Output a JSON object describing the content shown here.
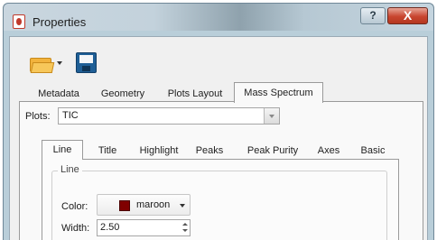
{
  "window": {
    "title": "Properties",
    "help_label": "?",
    "close_label": "X"
  },
  "toolbar": {
    "open_icon": "folder-open-icon",
    "save_icon": "save-disk-icon"
  },
  "top_tabs": [
    {
      "label": "Metadata",
      "active": false
    },
    {
      "label": "Geometry",
      "active": false
    },
    {
      "label": "Plots Layout",
      "active": false
    },
    {
      "label": "Mass Spectrum",
      "active": true
    }
  ],
  "plots": {
    "label": "Plots:",
    "selected": "TIC"
  },
  "inner_tabs": [
    {
      "label": "Line",
      "active": true
    },
    {
      "label": "Title",
      "active": false
    },
    {
      "label": "Highlight",
      "active": false
    },
    {
      "label": "Peaks",
      "active": false
    },
    {
      "label": "Peak Purity",
      "active": false
    },
    {
      "label": "Axes",
      "active": false
    },
    {
      "label": "Basic",
      "active": false
    }
  ],
  "line_group": {
    "title": "Line",
    "color_label": "Color:",
    "color_name": "maroon",
    "color_value": "#800000",
    "width_label": "Width:",
    "width_value": "2.50"
  }
}
